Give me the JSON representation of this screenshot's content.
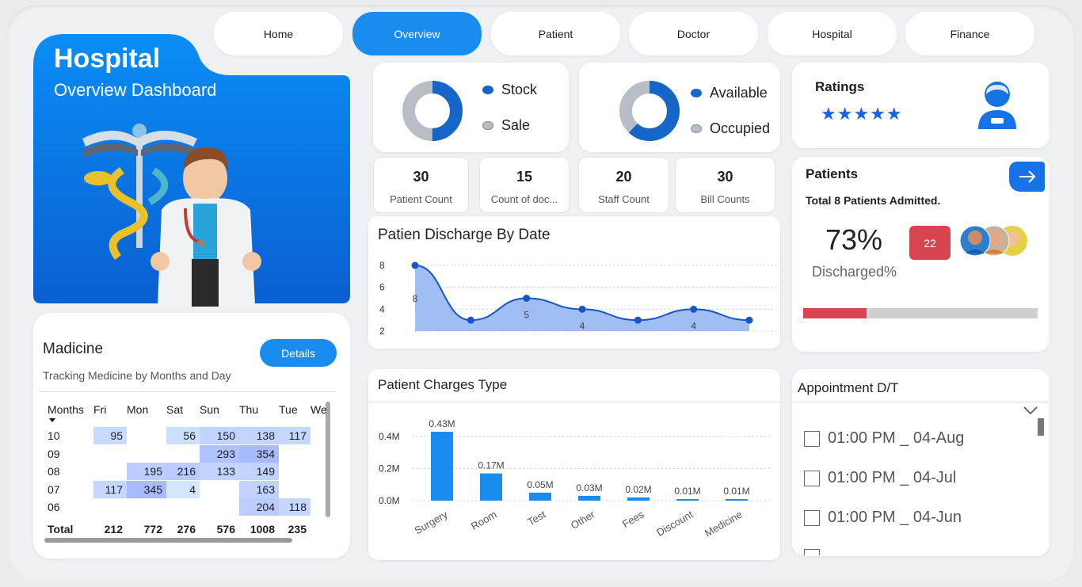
{
  "nav": {
    "tabs": [
      {
        "label": "Home"
      },
      {
        "label": "Overview",
        "active": true
      },
      {
        "label": "Patient"
      },
      {
        "label": "Doctor"
      },
      {
        "label": "Hospital"
      },
      {
        "label": "Finance"
      }
    ]
  },
  "hero": {
    "title": "Hospital",
    "subtitle": "Overview Dashboard"
  },
  "donut_stock": {
    "legend": [
      {
        "label": "Stock",
        "color": "#1665c8"
      },
      {
        "label": "Sale",
        "color": "#b8bec6"
      }
    ],
    "fraction_first": 0.5
  },
  "donut_beds": {
    "legend": [
      {
        "label": "Available",
        "color": "#1665c8"
      },
      {
        "label": "Occupied",
        "color": "#b8bec6"
      }
    ],
    "fraction_first": 0.62
  },
  "ratings": {
    "title": "Ratings",
    "stars": "★★★★★",
    "icon": "doctor-user-icon"
  },
  "kpis": [
    {
      "value": "30",
      "label": "Patient Count"
    },
    {
      "value": "15",
      "label": "Count of doc..."
    },
    {
      "value": "20",
      "label": "Staff Count"
    },
    {
      "value": "30",
      "label": "Bill Counts"
    }
  ],
  "discharge": {
    "title": "Patien Discharge By Date",
    "chart_data": {
      "type": "area",
      "title": "Patien Discharge By Date",
      "y_ticks": [
        "8",
        "6",
        "4",
        "2"
      ],
      "ylim": [
        2,
        8
      ],
      "values": [
        8,
        3,
        5,
        4,
        3,
        4,
        3
      ],
      "labels": [
        "8",
        "",
        "5",
        "4",
        "",
        "4",
        ""
      ],
      "color": "#1556c7",
      "fill": "#8fb3ee"
    }
  },
  "patients": {
    "title": "Patients",
    "subtitle": "Total 8 Patients Admitted.",
    "percent": "73%",
    "percent_label": "Discharged%",
    "badge": "22",
    "progress_red_fraction": 0.27
  },
  "medicine": {
    "title": "Madicine",
    "subtitle": "Tracking Medicine by Months and Day",
    "details_label": "Details",
    "columns": [
      "Months",
      "Fri",
      "Mon",
      "Sat",
      "Sun",
      "Thu",
      "Tue",
      "We"
    ],
    "rows": [
      {
        "month": "10",
        "cells": [
          "95",
          "",
          "56",
          "150",
          "138",
          "117",
          ""
        ]
      },
      {
        "month": "09",
        "cells": [
          "",
          "",
          "",
          "293",
          "354",
          "",
          ""
        ]
      },
      {
        "month": "08",
        "cells": [
          "",
          "195",
          "216",
          "133",
          "149",
          "",
          ""
        ]
      },
      {
        "month": "07",
        "cells": [
          "117",
          "345",
          "4",
          "",
          "163",
          "",
          ""
        ]
      },
      {
        "month": "06",
        "cells": [
          "",
          "",
          "",
          "",
          "204",
          "118",
          ""
        ]
      }
    ],
    "total": {
      "label": "Total",
      "cells": [
        "212",
        "772",
        "276",
        "576",
        "1008",
        "235"
      ]
    }
  },
  "charges": {
    "title": "Patient Charges Type",
    "chart_data": {
      "type": "bar",
      "title": "Patient Charges Type",
      "categories": [
        "Surgery",
        "Room",
        "Test",
        "Other",
        "Fees",
        "Discount",
        "Medicine"
      ],
      "values": [
        0.43,
        0.17,
        0.05,
        0.03,
        0.02,
        0.01,
        0.01
      ],
      "labels": [
        "0.43M",
        "0.17M",
        "0.05M",
        "0.03M",
        "0.02M",
        "0.01M",
        "0.01M"
      ],
      "y_ticks": [
        "0.4M",
        "0.2M",
        "0.0M"
      ],
      "ylim": [
        0,
        0.45
      ],
      "color": "#1a8cf0"
    }
  },
  "appointments": {
    "title": "Appointment D/T",
    "items": [
      "01:00 PM _ 04-Aug",
      "01:00 PM _ 04-Jul",
      "01:00 PM _ 04-Jun"
    ]
  }
}
